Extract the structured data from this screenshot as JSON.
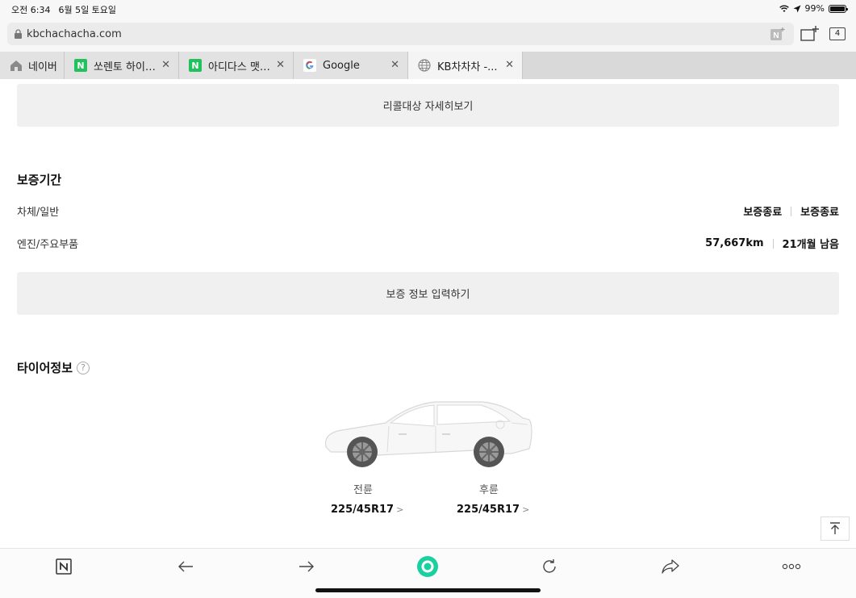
{
  "status": {
    "time": "오전 6:34",
    "date": "6월 5일 토요일",
    "battery": "99%",
    "battery_level": 0.99
  },
  "url": {
    "text": "kbchachacha.com"
  },
  "tab_count": "4",
  "tabs": [
    {
      "label": "네이버",
      "icon": "home-icon"
    },
    {
      "label": "쏘렌토 하이…",
      "icon": "naver-n-icon"
    },
    {
      "label": "아디다스 맷…",
      "icon": "naver-n-icon"
    },
    {
      "label": "Google",
      "icon": "google-g-icon"
    },
    {
      "label": "KB차차차 -...",
      "icon": "globe-icon"
    }
  ],
  "recall": {
    "button_label": "리콜대상 자세히보기"
  },
  "warranty": {
    "title": "보증기간",
    "rows": [
      {
        "label": "차체/일반",
        "value1": "보증종료",
        "value2": "보증종료"
      },
      {
        "label": "엔진/주요부품",
        "value1": "57,667km",
        "value2": "21개월 남음"
      }
    ],
    "button_label": "보증 정보 입력하기"
  },
  "tire": {
    "title": "타이어정보",
    "help": "?",
    "front_label": "전륜",
    "front_size": "225/45R17",
    "rear_label": "후륜",
    "rear_size": "225/45R17",
    "chevron": ">"
  },
  "colors": {
    "naver_green": "#21c25e",
    "whale_green": "#1bd0a0"
  }
}
